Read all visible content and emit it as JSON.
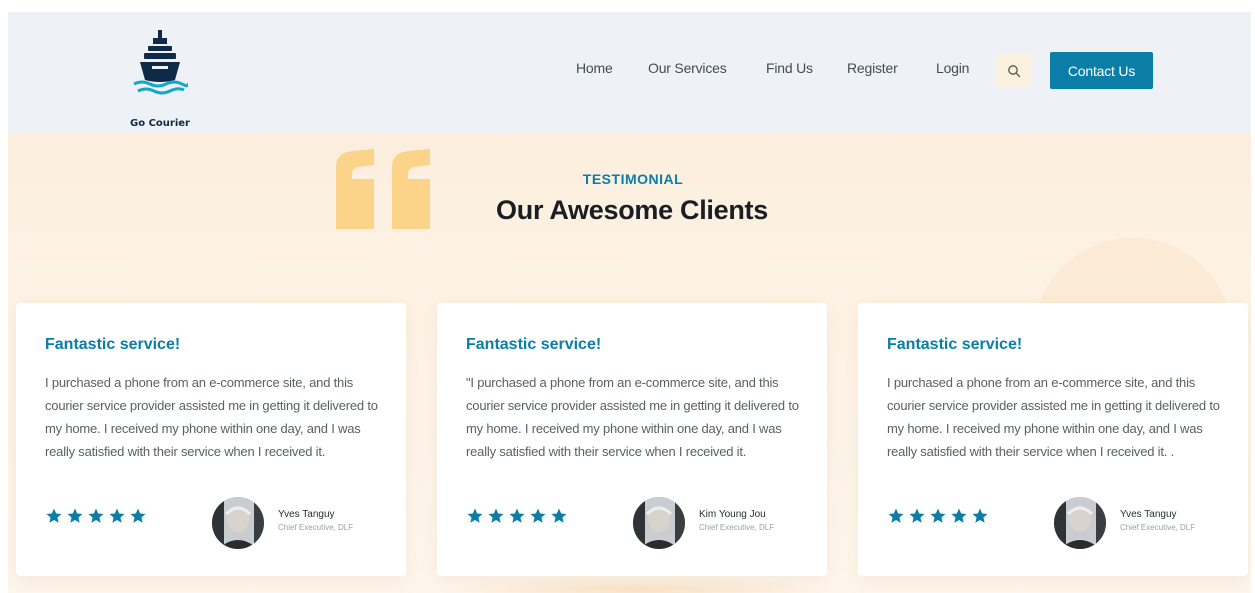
{
  "header": {
    "logo_text": "Go Courier",
    "nav": [
      {
        "label": "Home"
      },
      {
        "label": "Our Services"
      },
      {
        "label": "Find Us"
      },
      {
        "label": "Register"
      },
      {
        "label": "Login"
      }
    ],
    "search_icon": "search-icon",
    "contact_label": "Contact Us"
  },
  "section": {
    "eyebrow": "TESTIMONIAL",
    "title": "Our Awesome Clients"
  },
  "testimonials": [
    {
      "title": "Fantastic service!",
      "body": "I purchased a phone from an e-commerce site, and this courier service provider assisted me in getting it delivered to my home. I received my phone within one day, and I was really satisfied with their service when I received it.",
      "rating": 5,
      "name": "Yves Tanguy",
      "role": "Chief Executive, DLF"
    },
    {
      "title": "Fantastic service!",
      "body": "\"I purchased a phone from an e-commerce site, and this courier service provider assisted me in getting it delivered to my home. I received my phone within one day, and I was really satisfied with their service when I received it.",
      "rating": 5,
      "name": "Kim Young Jou",
      "role": "Chief Executive, DLF"
    },
    {
      "title": "Fantastic service!",
      "body": "I purchased a phone from an e-commerce site, and this courier service provider assisted me in getting it delivered to my home. I received my phone within one day, and I was really satisfied with their service when I received it. .",
      "rating": 5,
      "name": "Yves Tanguy",
      "role": "Chief Executive, DLF"
    }
  ],
  "colors": {
    "accent": "#0a7ea6",
    "quote": "#fbd48a",
    "header_bg": "#eef2f7",
    "section_bg": "#fdf3e6"
  }
}
